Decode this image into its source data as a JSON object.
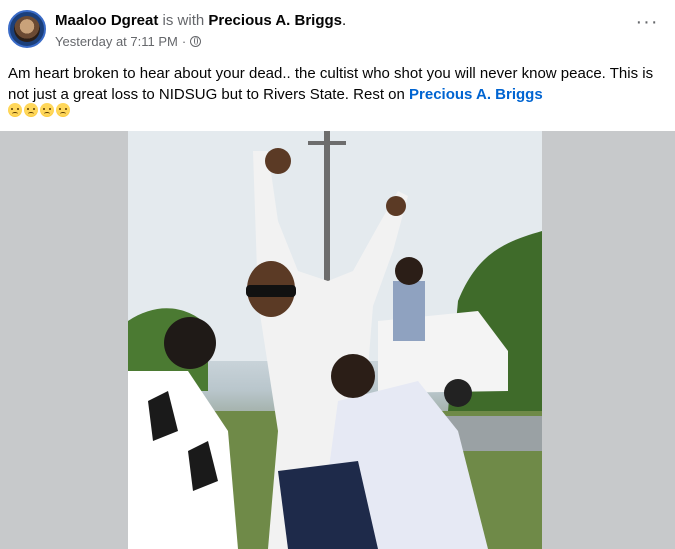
{
  "post": {
    "author": "Maaloo Dgreat",
    "with_text": " is with ",
    "tagged": "Precious A. Briggs",
    "tagged_suffix": ".",
    "timestamp": "Yesterday at 7:11 PM",
    "privacy_separator": "·",
    "privacy_icon": "globe-icon",
    "more_label": "···",
    "text": "Am heart broken to hear about your dead.. the cultist who shot you will never know peace. This is not just a great loss to NIDSUG but to Rivers State.  Rest on ",
    "text_mention": "Precious A. Briggs",
    "emojis": [
      "😥",
      "😥",
      "😥",
      "😥"
    ]
  },
  "photo": {
    "description_icon": "post-photo"
  },
  "colors": {
    "link": "#0064d1",
    "secondary_text": "#65676b",
    "photo_backdrop": "#c7c9cb"
  }
}
